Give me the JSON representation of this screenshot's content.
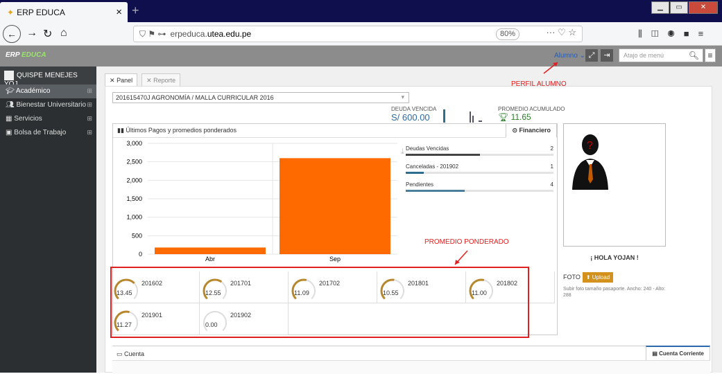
{
  "browser": {
    "tab_title": "ERP EDUCA",
    "url_host": "erpeduca.",
    "url_domain": "utea.edu.pe",
    "zoom": "80%"
  },
  "app": {
    "logo_a": "ERP",
    "logo_b": "EDUCA",
    "role": "Alumno",
    "search_placeholder": "Atajo de menú"
  },
  "sidebar": {
    "user": "QUISPE MENEJES YOJ...",
    "items": [
      {
        "label": "Académico",
        "icon": "graduation-icon"
      },
      {
        "label": "Bienestar Universitario",
        "icon": "people-icon"
      },
      {
        "label": "Servicios",
        "icon": "services-icon"
      },
      {
        "label": "Bolsa de Trabajo",
        "icon": "briefcase-icon"
      }
    ]
  },
  "tabs": [
    {
      "label": "Panel"
    },
    {
      "label": "Reporte"
    }
  ],
  "career": "201615470J AGRONOMÍA / MALLA CURRICULAR 2016",
  "deuda": {
    "label": "DEUDA VENCIDA",
    "value": "S/ 600.00"
  },
  "promedio": {
    "label": "PROMEDIO ACUMULADO",
    "value": "11.65"
  },
  "chart_section": {
    "title": "Últimos Pagos y promedios ponderados",
    "tab": "Financiero"
  },
  "chart_data": {
    "type": "bar",
    "categories": [
      "Abr",
      "Sep"
    ],
    "values": [
      180,
      2600
    ],
    "ylim": [
      0,
      3000
    ],
    "yticks": [
      "0",
      "500",
      "1,000",
      "1,500",
      "2,000",
      "2,500",
      "3,000"
    ],
    "color": "#ff6a00"
  },
  "stats": [
    {
      "label": "Deudas Vencidas",
      "count": "2",
      "fraction": 0.5,
      "color": "#444444"
    },
    {
      "label": "Canceladas - 201902",
      "count": "1",
      "fraction": 0.12,
      "color": "#2c6e8c"
    },
    {
      "label": "Pendientes",
      "count": "4",
      "fraction": 0.4,
      "color": "#4a7f99"
    }
  ],
  "gauges": [
    {
      "value": "13.45",
      "period": "201602",
      "fraction": 0.67
    },
    {
      "value": "12.55",
      "period": "201701",
      "fraction": 0.63
    },
    {
      "value": "11.09",
      "period": "201702",
      "fraction": 0.55
    },
    {
      "value": "10.55",
      "period": "201801",
      "fraction": 0.53
    },
    {
      "value": "11.00",
      "period": "201802",
      "fraction": 0.55
    },
    {
      "value": "11.27",
      "period": "201901",
      "fraction": 0.56
    },
    {
      "value": "0.00",
      "period": "201902",
      "fraction": 0
    }
  ],
  "profile": {
    "greeting": "¡ HOLA YOJAN !",
    "foto_label": "FOTO",
    "upload": "Upload",
    "note": "Subir foto tamaño pasaporte. Ancho: 240 - Alto: 288"
  },
  "cuenta": {
    "title": "Cuenta",
    "tab": "Cuenta Corriente"
  },
  "annotations": {
    "perfil": "PERFIL ALUMNO",
    "promedio": "PROMEDIO PONDERADO"
  }
}
